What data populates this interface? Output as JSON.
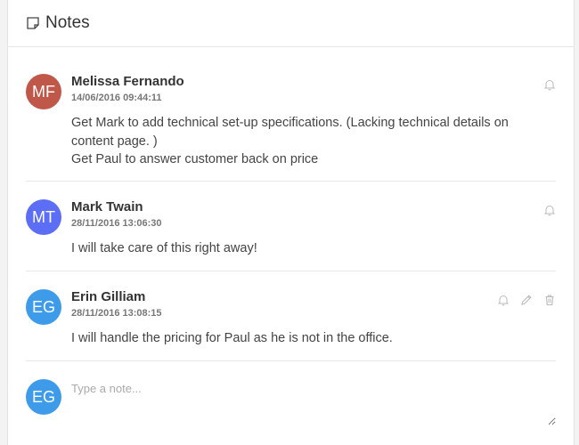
{
  "header": {
    "title": "Notes",
    "icon": "note-icon"
  },
  "notes": [
    {
      "initials": "MF",
      "avatar_color": "#c0584a",
      "author": "Melissa Fernando",
      "timestamp": "14/06/2016 09:44:11",
      "lines": [
        "Get Mark to add technical set-up specifications. (Lacking technical details on",
        "content page. )",
        "Get Paul to answer customer back on price"
      ],
      "actions": [
        "bell-icon"
      ]
    },
    {
      "initials": "MT",
      "avatar_color": "#5b6ef5",
      "author": "Mark Twain",
      "timestamp": "28/11/2016 13:06:30",
      "lines": [
        "I will take care of this right away!"
      ],
      "actions": [
        "bell-icon"
      ]
    },
    {
      "initials": "EG",
      "avatar_color": "#3d9be9",
      "author": "Erin Gilliam",
      "timestamp": "28/11/2016 13:08:15",
      "lines": [
        "I will handle the pricing for Paul as he is not in the office."
      ],
      "actions": [
        "bell-icon",
        "pencil-icon",
        "trash-icon"
      ]
    }
  ],
  "compose": {
    "initials": "EG",
    "avatar_color": "#3d9be9",
    "placeholder": "Type a note..."
  }
}
